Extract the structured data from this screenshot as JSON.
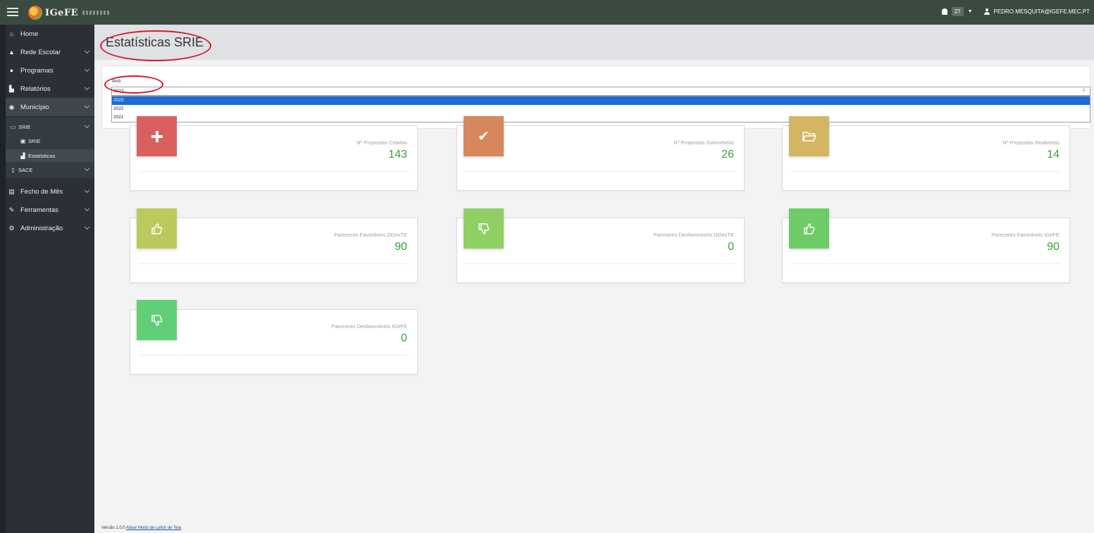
{
  "topbar": {
    "logo_text": "IGeFE",
    "notifications_count": "27",
    "user_email": "PEDRO.MESQUITA@IGEFE.MEC.PT"
  },
  "sidebar": {
    "items": [
      {
        "label": "Home",
        "icon": "home-icon"
      },
      {
        "label": "Rede Escolar",
        "icon": "graduation-cap-icon"
      },
      {
        "label": "Programas",
        "icon": "circle-arrow-icon"
      },
      {
        "label": "Relatórios",
        "icon": "bar-chart-icon"
      },
      {
        "label": "Município",
        "icon": "circle-dot-icon"
      },
      {
        "label": "Fecho de Mês",
        "icon": "calendar-icon"
      },
      {
        "label": "Ferramentas",
        "icon": "wrench-icon"
      },
      {
        "label": "Administração",
        "icon": "cogs-icon"
      }
    ],
    "sub_items": [
      {
        "label": "SRIE",
        "icon": "folder-open-icon"
      },
      {
        "label": "SRIE",
        "icon": "school-icon"
      },
      {
        "label": "Estatísticas",
        "icon": "area-chart-icon"
      },
      {
        "label": "SACE",
        "icon": "file-icon"
      }
    ]
  },
  "page": {
    "title": "Estatísticas SRIE"
  },
  "filter": {
    "ano_label": "Ano",
    "selected_value": "2023",
    "options": [
      "2023",
      "2022",
      "2021"
    ]
  },
  "cards": [
    {
      "label": "Nº Propostas Criadas",
      "value": "143",
      "icon": "plus-icon",
      "color": "#d9605f"
    },
    {
      "label": "Nº Propostas Submetidas",
      "value": "26",
      "icon": "check-icon",
      "color": "#d6875c"
    },
    {
      "label": "Nº Propostas Reabertas",
      "value": "14",
      "icon": "folder-open-icon",
      "color": "#d4b562"
    },
    {
      "label": "Pareceres Favoráveis DGesTE",
      "value": "90",
      "icon": "thumbs-up-icon",
      "color": "#bcc95c"
    },
    {
      "label": "Pareceres Desfavoráveis DGesTE",
      "value": "0",
      "icon": "thumbs-down-icon",
      "color": "#8fcf63"
    },
    {
      "label": "Pareceres Favoráveis IGeFE",
      "value": "90",
      "icon": "thumbs-up-icon",
      "color": "#6dcc66"
    },
    {
      "label": "Pareceres Desfavoráveis IGeFE",
      "value": "0",
      "icon": "thumbs-down-icon",
      "color": "#62ce76"
    }
  ],
  "footer": {
    "version": "Versão 1.0.0",
    "link": "Ativar Modo de Leitor de Tela"
  }
}
